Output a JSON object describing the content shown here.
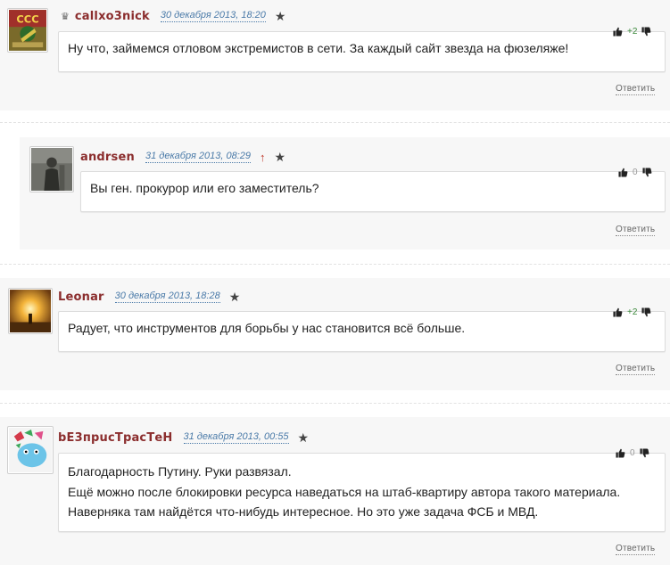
{
  "comments": [
    {
      "author": "callxo3nick",
      "date": "30 декабря 2013, 18:20",
      "score": "+2",
      "text": [
        "Ну что, займемся отловом экстремистов в сети. За каждый сайт звезда на фюзеляже!"
      ],
      "reply_label": "Ответить",
      "avatar_icon": "avatar-callxo3nick"
    },
    {
      "author": "andrsen",
      "date": "31 декабря 2013, 08:29",
      "parent_marker": "↑",
      "score": "0",
      "text": [
        "Вы ген. прокурор или его заместитель?"
      ],
      "reply_label": "Ответить",
      "avatar_icon": "avatar-andrsen"
    },
    {
      "author": "Leonar",
      "date": "30 декабря 2013, 18:28",
      "score": "+2",
      "text": [
        "Радует, что инструментов для борьбы у нас становится всё больше."
      ],
      "reply_label": "Ответить",
      "avatar_icon": "avatar-leonar"
    },
    {
      "author": "bE3прucТрасТеН",
      "date": "31 декабря 2013, 00:55",
      "score": "0",
      "text": [
        "Благодарность Путину. Руки развязал.",
        "Ещё можно после блокировки ресурса наведаться на штаб-квартиру автора такого материала.",
        "Наверняка там найдётся что-нибудь интересное. Но это уже задача ФСБ и МВД."
      ],
      "reply_label": "Ответить",
      "avatar_icon": "avatar-bezpristrasten"
    }
  ],
  "glyphs": {
    "crown": "♛",
    "star": "★"
  },
  "colors": {
    "author": "#8b2d2d",
    "date": "#4a7aa8",
    "score_positive": "#3c8a3c",
    "score_neutral": "#999999",
    "parent_arrow": "#c0392b"
  }
}
